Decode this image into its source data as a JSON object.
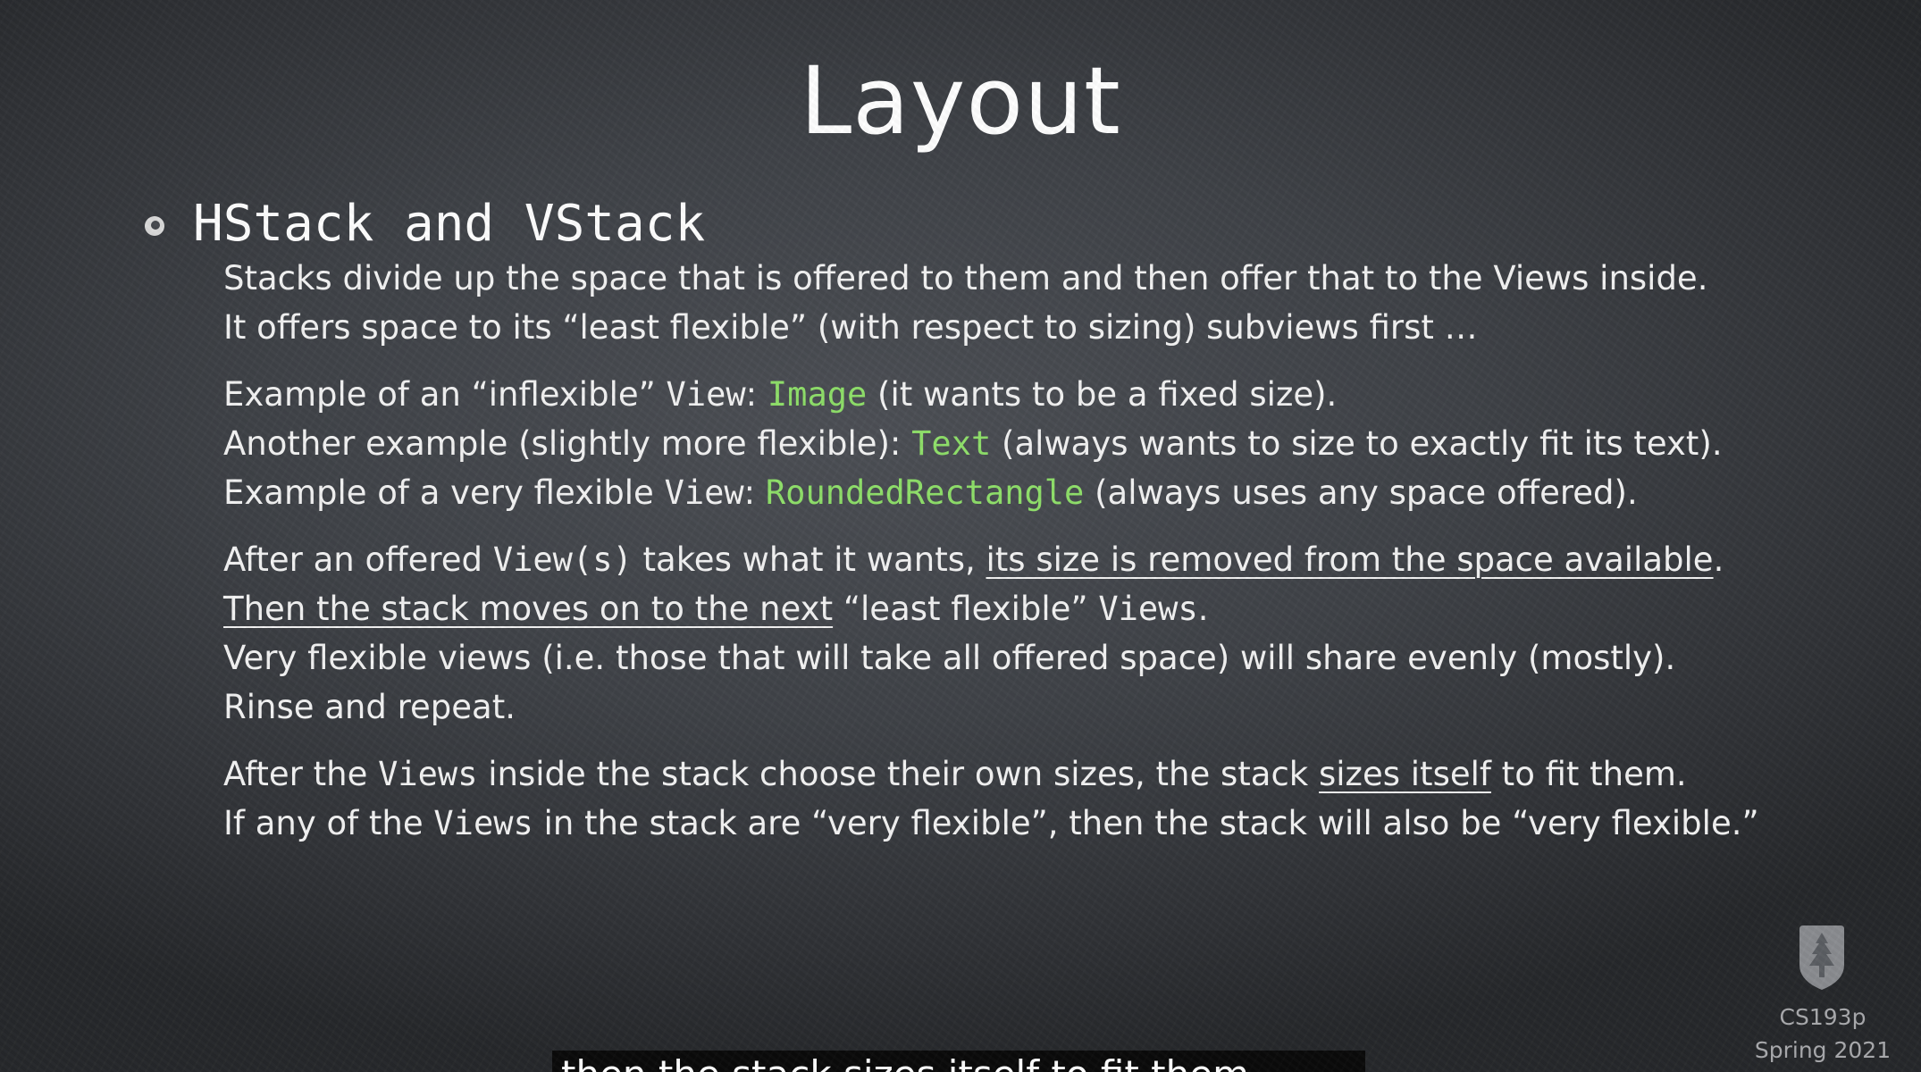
{
  "slide": {
    "title": "Layout",
    "heading": "HStack and VStack",
    "p1": {
      "l1": "Stacks divide up the space that is offered to them and then offer that to the Views inside.",
      "l2": "It offers space to its “least flexible” (with respect to sizing) subviews first …"
    },
    "p2": {
      "l1_a": "Example of an “inflexible” ",
      "l1_b": "View",
      "l1_c": ": ",
      "l1_code": "Image",
      "l1_d": " (it wants to be a fixed size).",
      "l2_a": "Another example (slightly more flexible): ",
      "l2_code": "Text",
      "l2_b": " (always wants to size to exactly fit its text).",
      "l3_a": "Example of a very flexible ",
      "l3_b": "View",
      "l3_c": ": ",
      "l3_code": "RoundedRectangle",
      "l3_d": " (always uses any space offered)."
    },
    "p3": {
      "l1_a": "After an offered ",
      "l1_b": "View(s)",
      "l1_c": " takes what it wants, ",
      "l1_u": "its size is removed from the space available",
      "l1_d": ".",
      "l2_u": "Then the stack moves on to the next",
      "l2_a": " “least flexible” ",
      "l2_b": "Views",
      "l2_c": ".",
      "l3": "Very flexible views (i.e. those that will take all offered space) will share evenly (mostly).",
      "l4": "Rinse and repeat."
    },
    "p4": {
      "l1_a": "After the ",
      "l1_b": "Views",
      "l1_c": " inside the stack choose their own sizes, the stack ",
      "l1_u": "sizes itself",
      "l1_d": " to fit them.",
      "l2_a": "If any of the ",
      "l2_b": "Views",
      "l2_c": " in the stack are “very flexible”, then the stack will also be “very flexible.”"
    },
    "course_code": "CS193p",
    "term": "Spring 2021"
  },
  "caption": {
    "text": "then the stack sizes itself to fit them."
  },
  "colors": {
    "code_green": "#8fe06a",
    "board": "#3f4247",
    "text": "#f3f3f3"
  },
  "icons": {
    "bullet": "chalk-bullet-icon",
    "logo": "stanford-tree-logo-icon"
  }
}
